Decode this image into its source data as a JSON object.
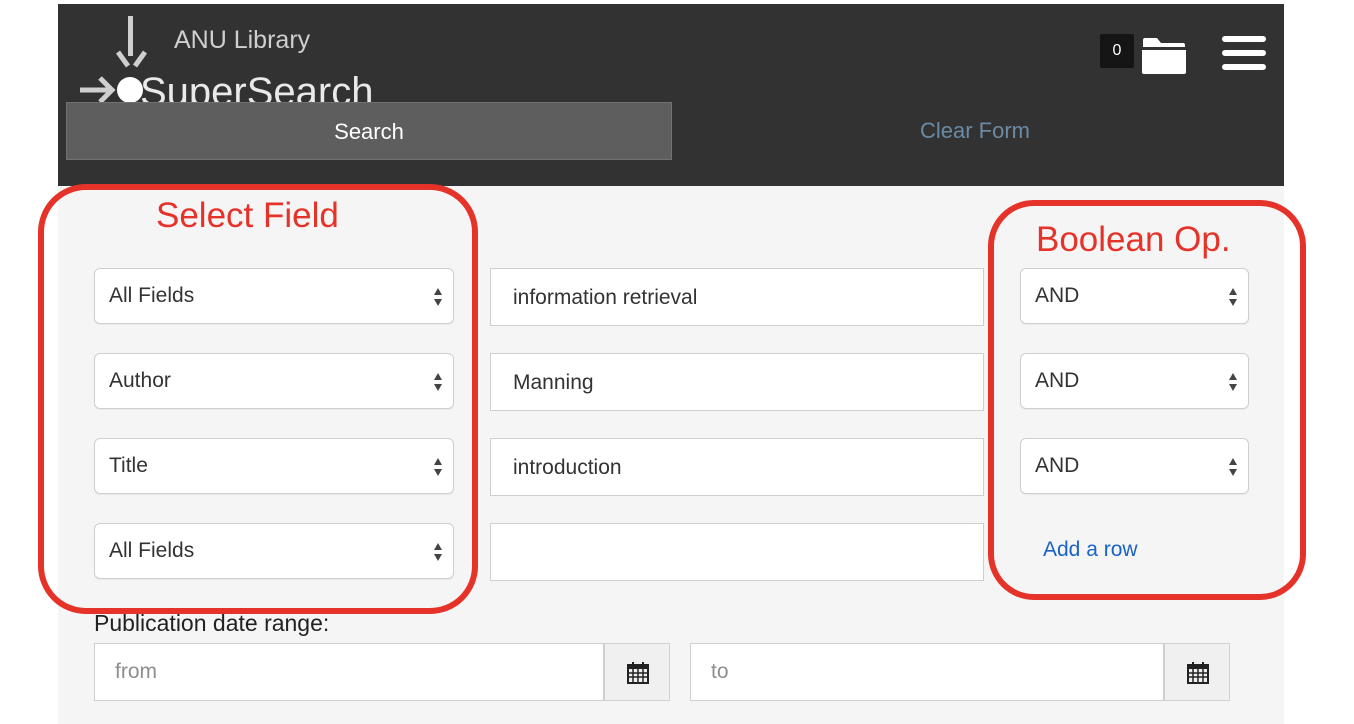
{
  "header": {
    "logo_subtitle": "ANU Library",
    "logo_title": "SuperSearch",
    "cart_count": "0",
    "tabs": {
      "search": "Search",
      "clear": "Clear Form"
    }
  },
  "rows": [
    {
      "field": "All Fields",
      "term": "information retrieval",
      "operator": "AND"
    },
    {
      "field": "Author",
      "term": "Manning",
      "operator": "AND"
    },
    {
      "field": "Title",
      "term": "introduction",
      "operator": "AND"
    },
    {
      "field": "All Fields",
      "term": "",
      "operator": null
    }
  ],
  "add_row_label": "Add a row",
  "date_range": {
    "label": "Publication date range:",
    "from_placeholder": "from",
    "to_placeholder": "to"
  },
  "annotations": {
    "select_field": "Select Field",
    "boolean_op": "Boolean Op."
  },
  "colors": {
    "header_bg": "#323232",
    "annotation": "#e5332a",
    "link": "#1a62c6"
  },
  "icons": [
    "logo-icon",
    "folder-icon",
    "menu-icon",
    "select-arrows-icon",
    "calendar-icon"
  ]
}
